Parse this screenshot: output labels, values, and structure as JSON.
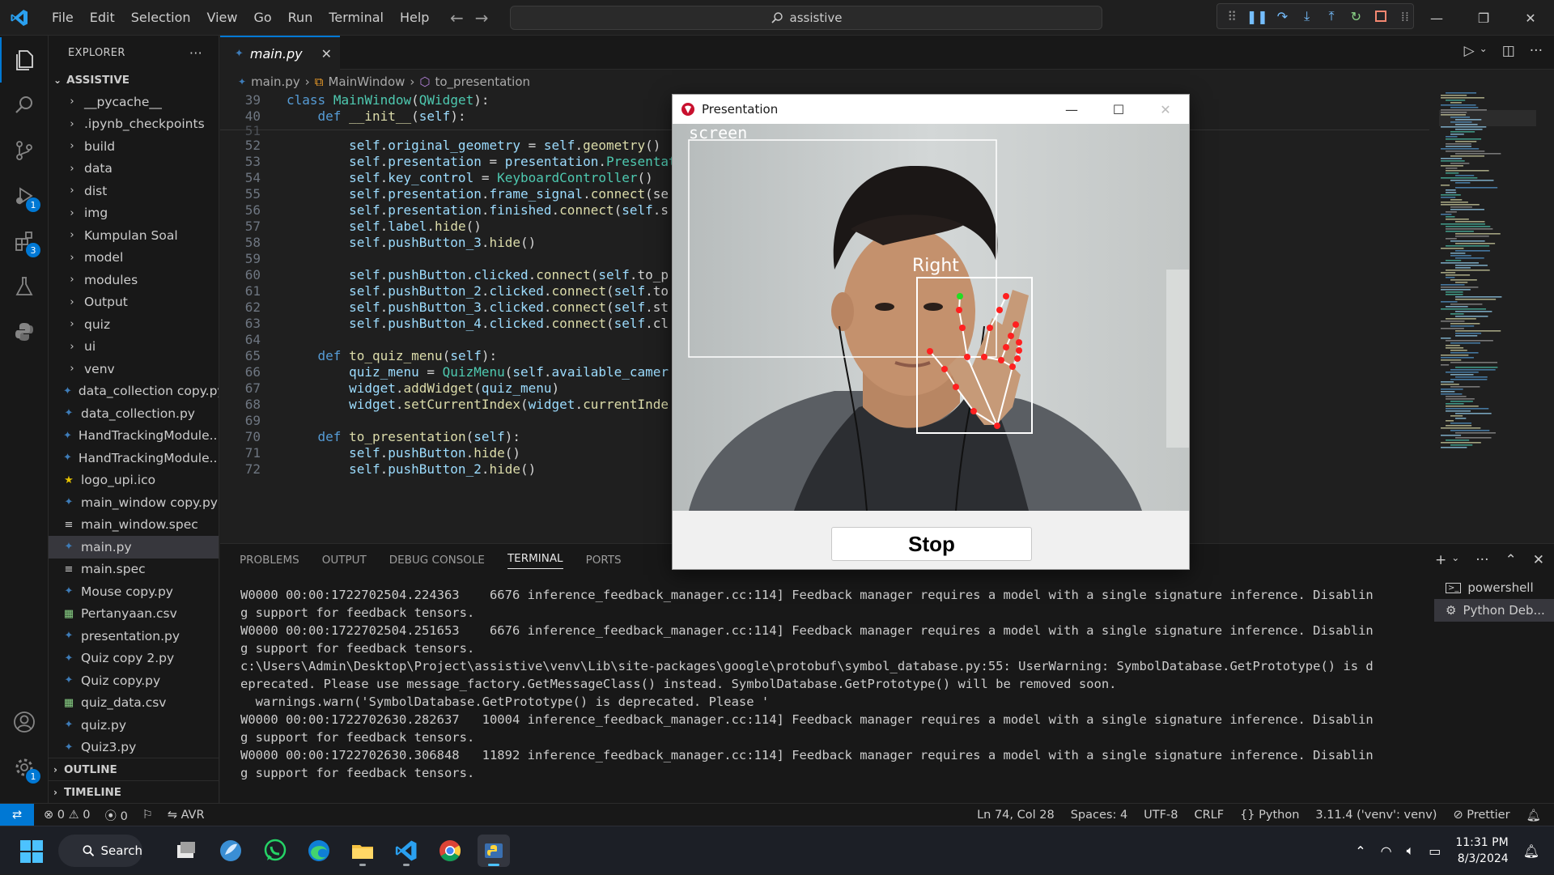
{
  "titlebar": {
    "menu": [
      "File",
      "Edit",
      "Selection",
      "View",
      "Go",
      "Run",
      "Terminal",
      "Help"
    ],
    "search": "assistive"
  },
  "activity_badges": {
    "debug": "1",
    "extensions": "3",
    "settings": "1"
  },
  "sidebar": {
    "header": "EXPLORER",
    "folder": "ASSISTIVE",
    "items": [
      {
        "label": "__pycache__",
        "type": "folder"
      },
      {
        "label": ".ipynb_checkpoints",
        "type": "folder"
      },
      {
        "label": "build",
        "type": "folder"
      },
      {
        "label": "data",
        "type": "folder"
      },
      {
        "label": "dist",
        "type": "folder"
      },
      {
        "label": "img",
        "type": "folder"
      },
      {
        "label": "Kumpulan Soal",
        "type": "folder"
      },
      {
        "label": "model",
        "type": "folder"
      },
      {
        "label": "modules",
        "type": "folder"
      },
      {
        "label": "Output",
        "type": "folder"
      },
      {
        "label": "quiz",
        "type": "folder"
      },
      {
        "label": "ui",
        "type": "folder"
      },
      {
        "label": "venv",
        "type": "folder"
      },
      {
        "label": "data_collection copy.py",
        "type": "py"
      },
      {
        "label": "data_collection.py",
        "type": "py"
      },
      {
        "label": "HandTrackingModule....",
        "type": "py"
      },
      {
        "label": "HandTrackingModule....",
        "type": "py"
      },
      {
        "label": "logo_upi.ico",
        "type": "ico"
      },
      {
        "label": "main_window copy.py",
        "type": "py"
      },
      {
        "label": "main_window.spec",
        "type": "spec"
      },
      {
        "label": "main.py",
        "type": "py",
        "selected": true
      },
      {
        "label": "main.spec",
        "type": "spec"
      },
      {
        "label": "Mouse copy.py",
        "type": "py"
      },
      {
        "label": "Pertanyaan.csv",
        "type": "csv"
      },
      {
        "label": "presentation.py",
        "type": "py"
      },
      {
        "label": "Quiz copy 2.py",
        "type": "py"
      },
      {
        "label": "Quiz copy.py",
        "type": "py"
      },
      {
        "label": "quiz_data.csv",
        "type": "csv"
      },
      {
        "label": "quiz.py",
        "type": "py"
      },
      {
        "label": "Quiz3.py",
        "type": "py"
      }
    ],
    "outline": "OUTLINE",
    "timeline": "TIMELINE"
  },
  "editor": {
    "tab": "main.py",
    "breadcrumb": [
      "main.py",
      "MainWindow",
      "to_presentation"
    ],
    "line_numbers": [
      "39",
      "40",
      "51",
      "52",
      "53",
      "54",
      "55",
      "56",
      "57",
      "58",
      "59",
      "60",
      "61",
      "62",
      "63",
      "64",
      "65",
      "66",
      "67",
      "68",
      "69",
      "70",
      "71",
      "72"
    ]
  },
  "panel": {
    "tabs": [
      "PROBLEMS",
      "OUTPUT",
      "DEBUG CONSOLE",
      "TERMINAL",
      "PORTS"
    ],
    "active_tab": "TERMINAL",
    "terminal_lines": [
      "W0000 00:00:1722702504.224363    6676 inference_feedback_manager.cc:114] Feedback manager requires a model with a single signature inference. Disablin",
      "g support for feedback tensors.",
      "W0000 00:00:1722702504.251653    6676 inference_feedback_manager.cc:114] Feedback manager requires a model with a single signature inference. Disablin",
      "g support for feedback tensors.",
      "c:\\Users\\Admin\\Desktop\\Project\\assistive\\venv\\Lib\\site-packages\\google\\protobuf\\symbol_database.py:55: UserWarning: SymbolDatabase.GetPrototype() is d",
      "eprecated. Please use message_factory.GetMessageClass() instead. SymbolDatabase.GetPrototype() will be removed soon.",
      "  warnings.warn('SymbolDatabase.GetPrototype() is deprecated. Please '",
      "W0000 00:00:1722702630.282637   10004 inference_feedback_manager.cc:114] Feedback manager requires a model with a single signature inference. Disablin",
      "g support for feedback tensors.",
      "W0000 00:00:1722702630.306848   11892 inference_feedback_manager.cc:114] Feedback manager requires a model with a single signature inference. Disablin",
      "g support for feedback tensors."
    ],
    "terminals": [
      "powershell",
      "Python Deb..."
    ]
  },
  "statusbar": {
    "errors": "0",
    "warnings": "0",
    "ports": "0",
    "avr": "AVR",
    "position": "Ln 74, Col 28",
    "spaces": "Spaces: 4",
    "encoding": "UTF-8",
    "eol": "CRLF",
    "language": "Python",
    "interpreter": "3.11.4 ('venv': venv)",
    "prettier": "Prettier"
  },
  "taskbar": {
    "search": "Search",
    "time": "11:31 PM",
    "date": "8/3/2024"
  },
  "presentation_window": {
    "title": "Presentation",
    "overlay_screen_label": "screen",
    "overlay_hand_label": "Right",
    "button": "Stop"
  },
  "colors": {
    "accent": "#0078d4",
    "keyword": "#569cd6",
    "function": "#dcdcaa",
    "class": "#4ec9b0",
    "variable": "#9cdcfe",
    "landmark": "#ff2020"
  }
}
